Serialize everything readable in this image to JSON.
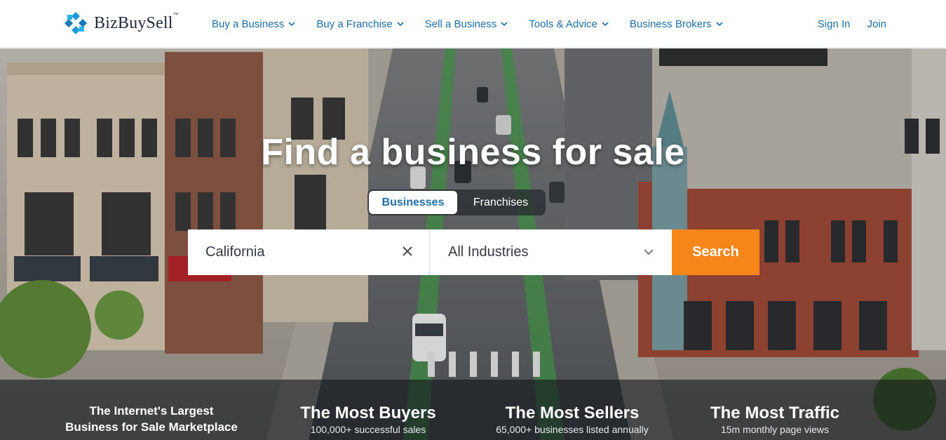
{
  "header": {
    "logo_text": "BizBuySell",
    "logo_tm": "™",
    "nav": [
      {
        "label": "Buy a Business"
      },
      {
        "label": "Buy a Franchise"
      },
      {
        "label": "Sell a Business"
      },
      {
        "label": "Tools & Advice"
      },
      {
        "label": "Business Brokers"
      }
    ],
    "sign_in": "Sign In",
    "join": "Join"
  },
  "hero": {
    "title": "Find a business for sale",
    "tabs": [
      {
        "label": "Businesses",
        "active": true
      },
      {
        "label": "Franchises",
        "active": false
      }
    ],
    "location_value": "California",
    "industry_value": "All Industries",
    "search_label": "Search"
  },
  "stats": {
    "lead_line1": "The Internet's Largest",
    "lead_line2": "Business for Sale Marketplace",
    "items": [
      {
        "title": "The Most Buyers",
        "sub": "100,000+ successful sales"
      },
      {
        "title": "The Most Sellers",
        "sub": "65,000+ businesses listed annually"
      },
      {
        "title": "The Most Traffic",
        "sub": "15m monthly page views"
      }
    ]
  },
  "colors": {
    "brand_blue": "#1e6fa8",
    "accent_orange": "#f7861a",
    "logo_teal": "#1b9ad6"
  },
  "icons": [
    "logo-mark-icon",
    "chevron-down-icon",
    "clear-x-icon"
  ]
}
